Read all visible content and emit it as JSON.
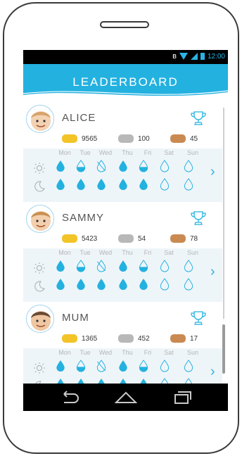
{
  "status": {
    "time": "12:00"
  },
  "header": {
    "title": "LEADERBOARD"
  },
  "days": [
    "Mon",
    "Tue",
    "Wed",
    "Thu",
    "Fri",
    "Sat",
    "Sun"
  ],
  "colors": {
    "accent": "#23b1e0",
    "gold": "#f2c428",
    "silver": "#b8b8b8",
    "bronze": "#c98a52"
  },
  "players": [
    {
      "name": "ALICE",
      "gold": "9565",
      "silver": "100",
      "bronze": "45",
      "day_drops": [
        "full",
        "half",
        "crossed",
        "full",
        "half",
        "empty",
        "empty"
      ],
      "night_drops": [
        "full",
        "full",
        "full",
        "full",
        "full",
        "empty",
        "empty"
      ]
    },
    {
      "name": "SAMMY",
      "gold": "5423",
      "silver": "54",
      "bronze": "78",
      "day_drops": [
        "full",
        "half",
        "crossed",
        "full",
        "half",
        "empty",
        "empty"
      ],
      "night_drops": [
        "full",
        "full",
        "full",
        "full",
        "full",
        "empty",
        "empty"
      ]
    },
    {
      "name": "MUM",
      "gold": "1365",
      "silver": "452",
      "bronze": "17",
      "day_drops": [
        "full",
        "half",
        "crossed",
        "full",
        "half",
        "empty",
        "empty"
      ],
      "night_drops": [
        "full",
        "full",
        "full",
        "full",
        "full",
        "empty",
        "empty"
      ]
    }
  ],
  "icons": {
    "sun": "sun-icon",
    "moon": "moon-icon",
    "trophy": "trophy-icon",
    "back": "back-icon",
    "home": "home-icon",
    "recents": "recents-icon"
  }
}
